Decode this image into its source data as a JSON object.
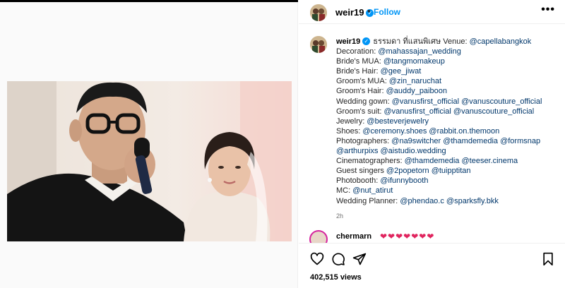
{
  "post": {
    "username": "weir19",
    "follow_label": "Follow",
    "more_label": "•••",
    "separator": "•",
    "verified_mark": "✓",
    "timestamp": "2h",
    "views": "402,515 views"
  },
  "caption": {
    "username": "weir19",
    "lines": [
      {
        "label": "ธรรมดา ที่แสนพิเศษ Venue: ",
        "links": "@capellabangkok"
      },
      {
        "label": "Decoration: ",
        "links": "@mahassajan_wedding"
      },
      {
        "label": "Bride's MUA: ",
        "links": "@tangmomakeup"
      },
      {
        "label": "Bride's Hair: ",
        "links": "@gee_jiwat"
      },
      {
        "label": "Groom's MUA: ",
        "links": "@zin_naruchat"
      },
      {
        "label": "Groom's Hair: ",
        "links": "@auddy_paiboon"
      },
      {
        "label": "Wedding gown: ",
        "links": "@vanusfirst_official @vanuscouture_official"
      },
      {
        "label": "Groom's suit: ",
        "links": "@vanusfirst_official @vanuscouture_official"
      },
      {
        "label": "Jewelry: ",
        "links": "@besteverjewelry"
      },
      {
        "label": "Shoes: ",
        "links": "@ceremony.shoes @rabbit.on.themoon"
      },
      {
        "label": "Photographers: ",
        "links": "@na9switcher @thamdemedia @formsnap"
      },
      {
        "label": "",
        "links": "@arthurpixs @aistudio.wedding"
      },
      {
        "label": "Cinematographers: ",
        "links": "@thamdemedia @teeser.cinema"
      },
      {
        "label": "Guest singers ",
        "links": "@2popetorn @tuipptitan"
      },
      {
        "label": "Photobooth: ",
        "links": "@ifunnybooth"
      },
      {
        "label": "MC: ",
        "links": "@nut_atirut"
      },
      {
        "label": "Wedding Planner: ",
        "links": "@phendao.c @sparksfly.bkk"
      }
    ]
  },
  "comment": {
    "username": "chermarn",
    "text": "❤❤❤❤❤❤❤"
  },
  "actions": {
    "like_icon": "heart-icon",
    "comment_icon": "comment-icon",
    "share_icon": "share-icon",
    "save_icon": "bookmark-icon"
  }
}
